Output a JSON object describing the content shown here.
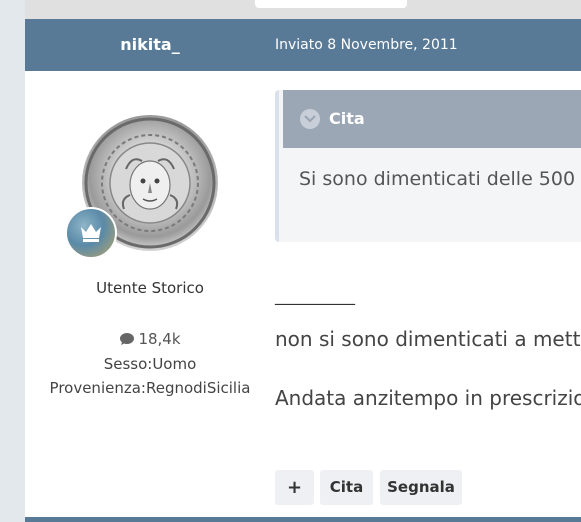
{
  "post": {
    "author": "nikita_",
    "date": "Inviato 8 Novembre, 2011",
    "rank": "Utente Storico",
    "post_count": "18,4k",
    "sex_label": "Sesso:Uomo",
    "location_label": "Provenienza:RegnodiSicilia"
  },
  "quote": {
    "title": "Cita",
    "text": "Si sono dimenticati delle 500"
  },
  "body": {
    "separator": "__________",
    "paragraph1": "non si sono dimenticati a mette",
    "paragraph2": "Andata anzitempo in prescrizion"
  },
  "actions": {
    "plus": "+",
    "quote": "Cita",
    "report": "Segnala"
  },
  "colors": {
    "header_bg": "#587a96",
    "quote_head_bg": "#9ca7b6",
    "button_bg": "#eef0f3"
  },
  "icons": {
    "avatar": "medusa-medallion-avatar",
    "badge": "crown-badge-icon",
    "posts": "speech-bubble-icon",
    "toggle": "chevron-down-icon"
  }
}
